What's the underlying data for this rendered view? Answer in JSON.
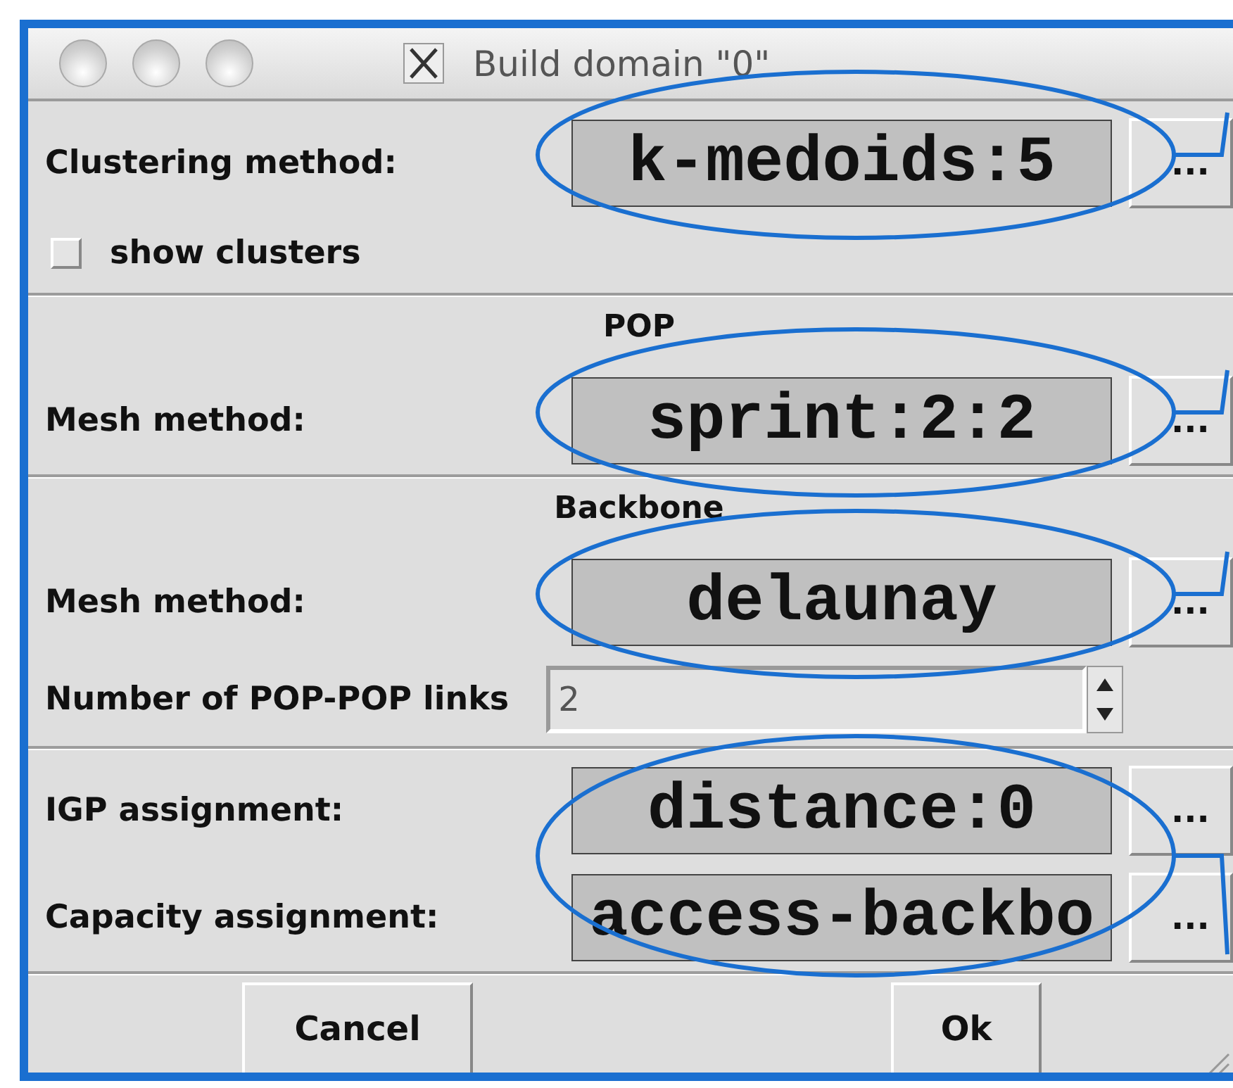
{
  "window": {
    "title": "Build domain \"0\""
  },
  "sections": [
    {
      "annotated": true,
      "leader_down": false,
      "rows": [
        {
          "kind": "select",
          "label": "Clustering method:",
          "value": "k-medoids:5",
          "button": "..."
        },
        {
          "kind": "checkbox",
          "label": "show clusters",
          "checked": false
        }
      ]
    },
    {
      "heading": "POP",
      "annotated": true,
      "leader_down": false,
      "rows": [
        {
          "kind": "select",
          "label": "Mesh method:",
          "value": "sprint:2:2",
          "button": "..."
        }
      ]
    },
    {
      "heading": "Backbone",
      "annotated": true,
      "leader_down": false,
      "rows": [
        {
          "kind": "select",
          "label": "Mesh method:",
          "value": "delaunay",
          "button": "..."
        },
        {
          "kind": "spin",
          "label": "Number of POP-POP links",
          "value": "2"
        }
      ]
    },
    {
      "annotated": true,
      "leader_down": true,
      "rows": [
        {
          "kind": "select",
          "label": "IGP assignment:",
          "value": "distance:0",
          "button": "..."
        },
        {
          "kind": "select",
          "label": "Capacity assignment:",
          "value": "access-backbo",
          "button": "..."
        }
      ]
    }
  ],
  "buttons": [
    "Cancel",
    "Ok"
  ]
}
